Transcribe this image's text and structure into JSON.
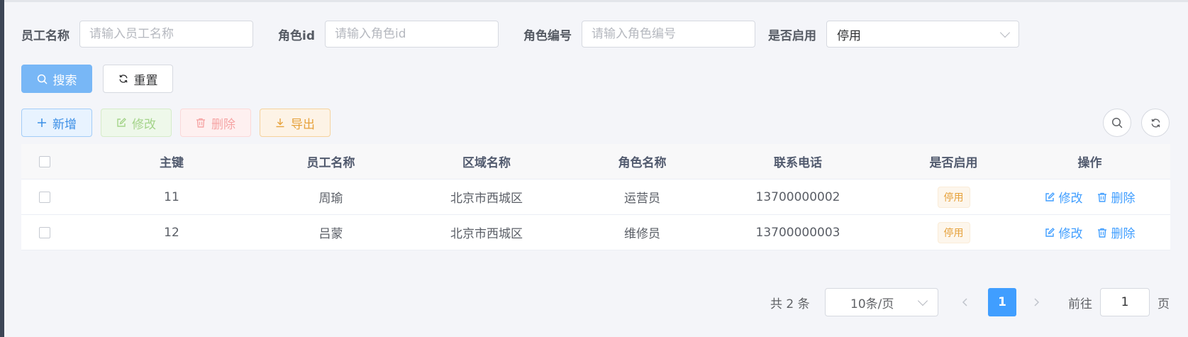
{
  "form": {
    "employee_name": {
      "label": "员工名称",
      "placeholder": "请输入员工名称",
      "value": ""
    },
    "role_id": {
      "label": "角色id",
      "placeholder": "请输入角色id",
      "value": ""
    },
    "role_code": {
      "label": "角色编号",
      "placeholder": "请输入角色编号",
      "value": ""
    },
    "enabled": {
      "label": "是否启用",
      "value": "停用"
    }
  },
  "actions": {
    "search": "搜索",
    "reset": "重置",
    "add": "新增",
    "edit": "修改",
    "delete": "删除",
    "export": "导出"
  },
  "table": {
    "headers": [
      "主键",
      "员工名称",
      "区域名称",
      "角色名称",
      "联系电话",
      "是否启用",
      "操作"
    ],
    "rows": [
      {
        "id": "11",
        "name": "周瑜",
        "area": "北京市西城区",
        "role": "运营员",
        "phone": "13700000002",
        "status": "停用",
        "edit": "修改",
        "delete": "删除"
      },
      {
        "id": "12",
        "name": "吕蒙",
        "area": "北京市西城区",
        "role": "维修员",
        "phone": "13700000003",
        "status": "停用",
        "edit": "修改",
        "delete": "删除"
      }
    ]
  },
  "pagination": {
    "total": "共 2 条",
    "page_size": "10条/页",
    "current_page": "1",
    "goto_label": "前往",
    "goto_value": "1",
    "page_suffix": "页"
  },
  "colors": {
    "primary": "#409eff",
    "warning": "#e6a23c",
    "success_light": "#a4d48a",
    "danger_light": "#f6a4a4"
  }
}
